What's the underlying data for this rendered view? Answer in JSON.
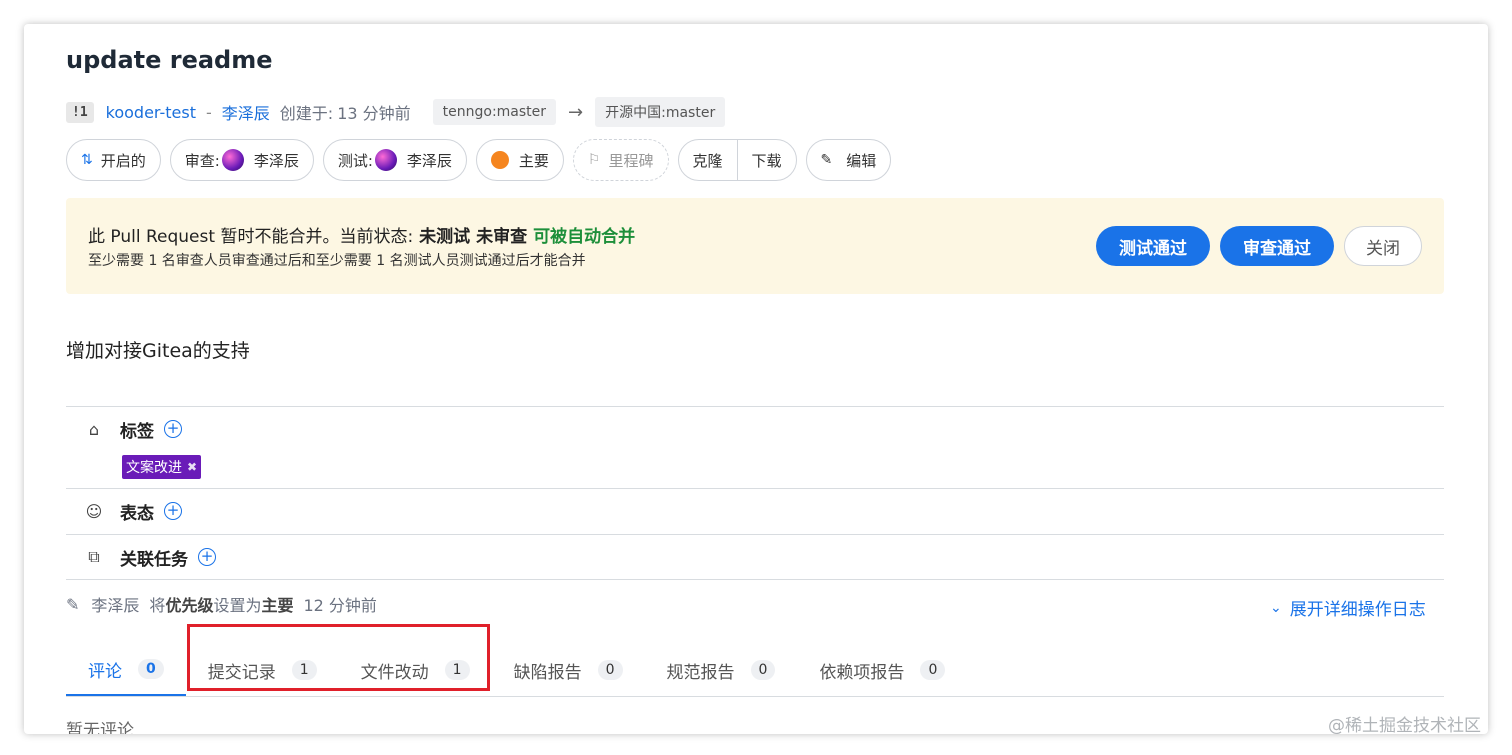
{
  "pr": {
    "title": "update readme",
    "number": "!1",
    "repo": "kooder-test",
    "separator": "-",
    "author": "李泽辰",
    "created_label": "创建于:",
    "created_time": "13 分钟前",
    "source_branch": "tenngo:master",
    "arrow": "→",
    "target_branch": "开源中国:master"
  },
  "pills": {
    "state": "开启的",
    "reviewer_label": "审查:",
    "reviewer_name": "李泽辰",
    "tester_label": "测试:",
    "tester_name": "李泽辰",
    "priority": "主要",
    "milestone": "里程碑",
    "clone": "克隆",
    "download": "下载",
    "edit": "编辑"
  },
  "notice": {
    "line1_prefix": "此 Pull Request 暂时不能合并。当前状态:",
    "status_untested": "未测试",
    "status_unreviewed": "未审查",
    "status_auto_merge": "可被自动合并",
    "line2": "至少需要 1 名审查人员审查通过后和至少需要 1 名测试人员测试通过后才能合并",
    "btn_test_pass": "测试通过",
    "btn_review_pass": "审查通过",
    "btn_close": "关闭"
  },
  "description": "增加对接Gitea的支持",
  "sections": {
    "labels_title": "标签",
    "label_tag": "文案改进",
    "reactions_title": "表态",
    "related_title": "关联任务"
  },
  "activity": {
    "user": "李泽辰",
    "pre": "将",
    "field": "优先级",
    "mid": "设置为",
    "value": "主要",
    "time": "12 分钟前",
    "expand_label": "展开详细操作日志"
  },
  "tabs": [
    {
      "label": "评论",
      "count": "0"
    },
    {
      "label": "提交记录",
      "count": "1"
    },
    {
      "label": "文件改动",
      "count": "1"
    },
    {
      "label": "缺陷报告",
      "count": "0"
    },
    {
      "label": "规范报告",
      "count": "0"
    },
    {
      "label": "依赖项报告",
      "count": "0"
    }
  ],
  "empty_comments": "暂无评论",
  "watermark": "@稀土掘金技术社区",
  "colors": {
    "accent": "#1a73e8",
    "notice_bg": "#fdf7e3",
    "auto_merge_green": "#1d8f3a",
    "label_purple": "#6a1bb8",
    "priority_orange": "#f5851f",
    "highlight_red": "#e0202a"
  }
}
